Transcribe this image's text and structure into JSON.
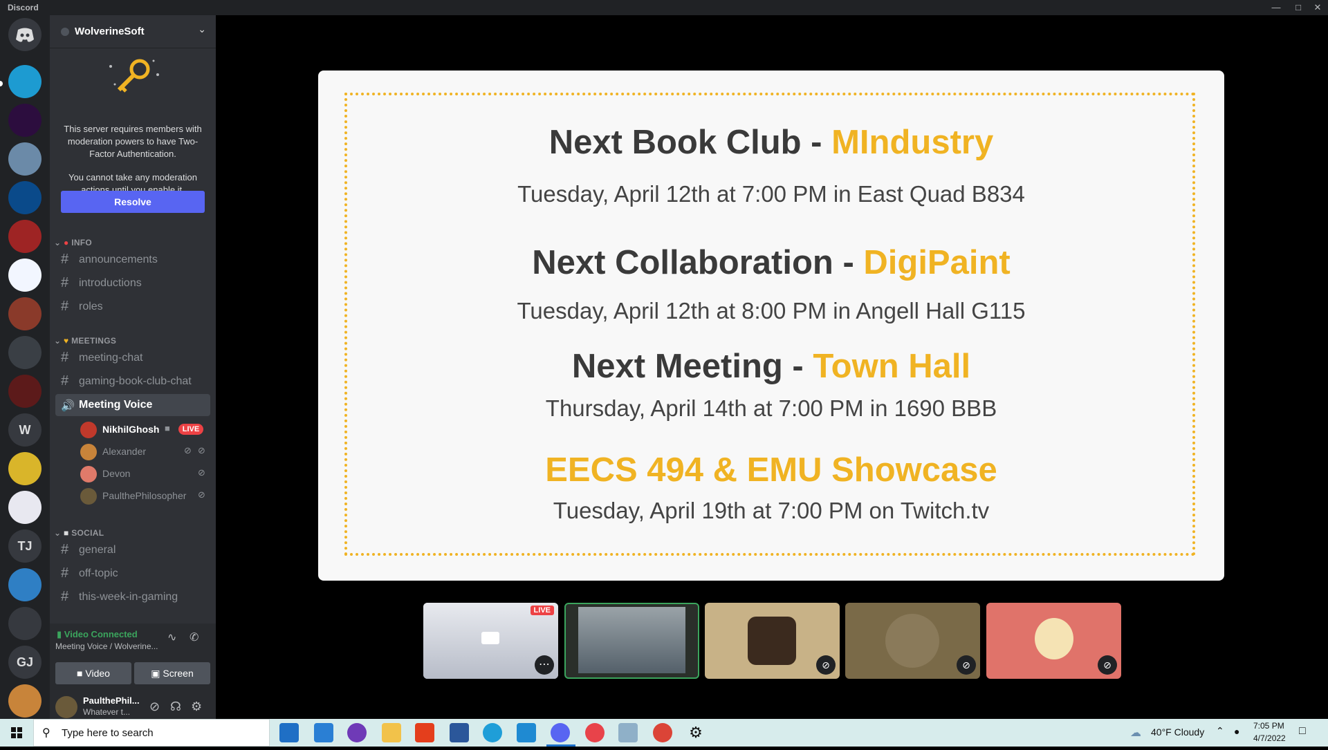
{
  "app": {
    "title": "Discord"
  },
  "server": {
    "name": "WolverineSoft",
    "twofa_message_1": "This server requires members with moderation powers to have Two-Factor Authentication.",
    "twofa_message_2": "You cannot take any moderation actions until you enable it.",
    "resolve_label": "Resolve"
  },
  "rail": {
    "initials": [
      "W",
      "TJ",
      "GJ"
    ]
  },
  "categories": {
    "info": "INFO",
    "meetings": "MEETINGS",
    "social": "SOCIAL"
  },
  "channels": {
    "info": [
      "announcements",
      "introductions",
      "roles"
    ],
    "meetings": [
      "meeting-chat",
      "gaming-book-club-chat"
    ],
    "voice": "Meeting Voice",
    "social": [
      "general",
      "off-topic",
      "this-week-in-gaming"
    ]
  },
  "voice_users": [
    {
      "name": "NikhilGhosh",
      "live": "LIVE"
    },
    {
      "name": "Alexander"
    },
    {
      "name": "Devon"
    },
    {
      "name": "PaulthePhilosopher"
    }
  ],
  "voice_panel": {
    "status": "Video Connected",
    "channel": "Meeting Voice / Wolverine...",
    "video_label": "Video",
    "screen_label": "Screen"
  },
  "user": {
    "name": "PaulthePhil...",
    "status": "Whatever t..."
  },
  "slide": {
    "h1_prefix": "Next Book Club - ",
    "h1_accent": "MIndustry",
    "s1": "Tuesday, April 12th at 7:00 PM in East Quad B834",
    "h2_prefix": "Next Collaboration - ",
    "h2_accent": "DigiPaint",
    "s2": "Tuesday, April 12th at 8:00 PM in Angell Hall G115",
    "h3_prefix": "Next Meeting - ",
    "h3_accent": "Town Hall",
    "s3": "Thursday, April 14th at 7:00 PM in 1690 BBB",
    "h4": "EECS 494 & EMU Showcase",
    "s4": "Tuesday, April 19th at 7:00 PM on Twitch.tv"
  },
  "tiles": {
    "live_badge": "LIVE"
  },
  "taskbar": {
    "search_placeholder": "Type here to search",
    "weather": "40°F  Cloudy",
    "time": "7:05 PM",
    "date": "4/7/2022"
  },
  "colors": {
    "accent": "#f0b323",
    "blurple": "#5865f2",
    "live": "#ed4245",
    "connected": "#3ba55d"
  }
}
